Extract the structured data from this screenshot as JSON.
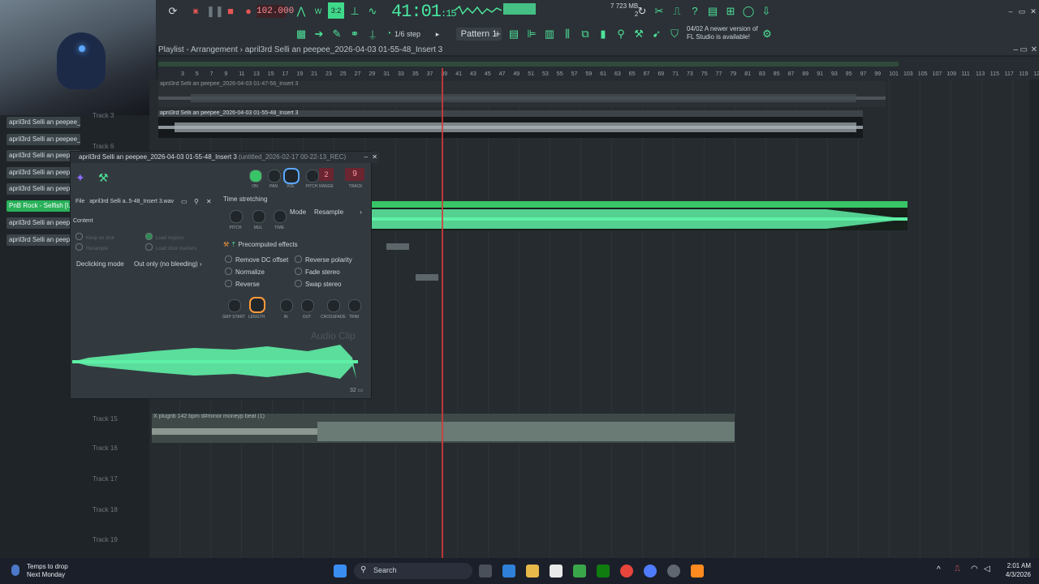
{
  "toolbar": {
    "tempo": "102.000",
    "time_main": "41:01",
    "time_sub": ":15",
    "snap": "1/6 step",
    "pattern": "Pattern 1",
    "memory": "723 MB",
    "cpu_line": "7",
    "voices": "2",
    "news_date": "04/02",
    "news_line1": "A newer version of",
    "news_line2": "FL Studio is available!"
  },
  "playlist": {
    "title_prefix": "Playlist - Arrangement",
    "title_sep": "›",
    "title_clip": "april3rd Selli an peepee_2026-04-03 01-55-48_Insert 3",
    "ruler": [
      "3",
      "5",
      "7",
      "9",
      "11",
      "13",
      "15",
      "17",
      "19",
      "21",
      "23",
      "25",
      "27",
      "29",
      "31",
      "33",
      "35",
      "37",
      "39",
      "41",
      "43",
      "45",
      "47",
      "49",
      "51",
      "53",
      "55",
      "57",
      "59",
      "61",
      "63",
      "65",
      "67",
      "69",
      "71",
      "73",
      "75",
      "77",
      "79",
      "81",
      "83",
      "85",
      "87",
      "89",
      "91",
      "93",
      "95",
      "97",
      "99",
      "101",
      "103",
      "105",
      "107",
      "109",
      "111",
      "113",
      "115",
      "117",
      "119",
      "121"
    ],
    "tracks": {
      "t3": "Track 3",
      "t6": "Track 6",
      "t15": "Track 15",
      "t16": "Track 16",
      "t17": "Track 17",
      "t18": "Track 18",
      "t19": "Track 19"
    },
    "clip1": "april3rd Selli an peepee_2026-04-03 01-47-56_Insert 3",
    "clip2": "april3rd Selli an peepee_2026-04-03 01-55-48_Insert 3",
    "clip_beat": "X plugnb 142 bpm d#minor moneyp beat (1)"
  },
  "picker": [
    "april3rd Selli an peepee_...",
    "april3rd Selli an peepee_...",
    "april3rd Selli an peepe",
    "april3rd Selli an peepe",
    "april3rd Selli an peepe",
    "PnB Rock - Selfish [I...",
    "april3rd Selli an peepe",
    "april3rd Selli an peepe"
  ],
  "channel_settings": {
    "title": "april3rd Selli an peepee_2026-04-03 01-55-48_Insert 3",
    "title_extra": "(untitled_2026-02-17 00-22-13_REC)",
    "knob_labels": [
      "ON",
      "PAN",
      "VOL",
      "PITCH",
      "RANGE",
      "TRACK"
    ],
    "range_value": "2",
    "track_value": "9",
    "file_label": "File",
    "file_name": "april3rd Selli a..5-48_Insert 3.wav",
    "content_label": "Content",
    "keep_on_disk": "Keep on disk",
    "resample": "Resample",
    "load_regions": "Load regions",
    "load_slice_markers": "Load slice markers",
    "declicking_label": "Declicking mode",
    "declicking_value": "Out only (no bleeding)",
    "time_stretching": "Time stretching",
    "mode_label": "Mode",
    "mode_value": "Resample",
    "ts_knobs": [
      "PITCH",
      "MUL",
      "TIME"
    ],
    "precomputed": "Precomputed effects",
    "remove_dc": "Remove DC offset",
    "normalize": "Normalize",
    "reverse": "Reverse",
    "reverse_polarity": "Reverse polarity",
    "fade_stereo": "Fade stereo",
    "swap_stereo": "Swap stereo",
    "fx_knobs": [
      "SMP START",
      "LENGTH",
      "IN",
      "OUT",
      "CROSSFADE",
      "TRIM"
    ],
    "audio_clip": "Audio Clip",
    "zoom": "32"
  },
  "taskbar": {
    "weather_line1": "Temps to drop",
    "weather_line2": "Next Monday",
    "search": "Search",
    "time": "2:01 AM",
    "date": "4/3/2026"
  },
  "colors": {
    "accent": "#4ee39a",
    "clip_green": "#5ff0a6",
    "playhead": "#d43a3a",
    "highlight": "#29b15a"
  }
}
